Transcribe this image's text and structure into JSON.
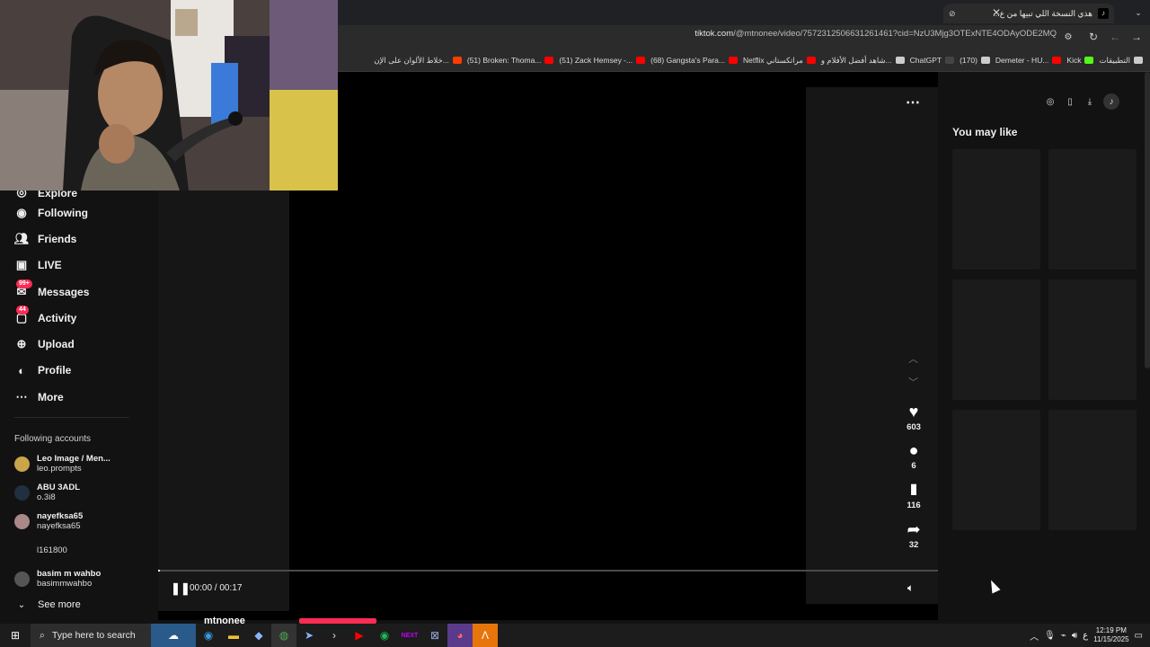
{
  "browser": {
    "tab_title": "هذي النسخة اللي تبيها من ع...",
    "tab_icon": "tiktok-icon",
    "url_host": "tiktok.com",
    "url_path": "/@mtnonee/video/7572312506631261461?cid=NzU3Mjg3OTExNTE4ODAyODE2MQ",
    "bookmarks": [
      {
        "label": "التطبيقات",
        "icon": "apps-grid-icon",
        "color": "#cccccc"
      },
      {
        "label": "Kick",
        "icon": "kick-icon",
        "color": "#53fc18"
      },
      {
        "label": "Demeter - HU...",
        "icon": "youtube-icon",
        "color": "#ff0000"
      },
      {
        "label": "(170)",
        "icon": "chatgpt-icon",
        "color": "#cccccc"
      },
      {
        "label": "ChatGPT",
        "icon": "gpt-icon",
        "color": "#444444"
      },
      {
        "label": "شاهد أفضل الأفلام و...",
        "icon": "globe-icon",
        "color": "#cccccc"
      },
      {
        "label": "Netflix مراتكستاني",
        "icon": "netflix-icon",
        "color": "#ff0000"
      },
      {
        "label": "(68) Gangsta's Para...",
        "icon": "youtube-icon",
        "color": "#ff0000"
      },
      {
        "label": "(51) Zack Hemsey -...",
        "icon": "youtube-icon",
        "color": "#ff0000"
      },
      {
        "label": "(51) Broken: Thoma...",
        "icon": "youtube-icon",
        "color": "#ff0000"
      },
      {
        "label": "خلاط الألوان على الإن...",
        "icon": "google-icon",
        "color": "#ff3d00"
      }
    ]
  },
  "sidebar": {
    "partial_top": "Explore",
    "items": [
      {
        "label": "Following",
        "icon": "following-icon",
        "badge": ""
      },
      {
        "label": "Friends",
        "icon": "friends-icon",
        "badge": ""
      },
      {
        "label": "LIVE",
        "icon": "live-icon",
        "badge": ""
      },
      {
        "label": "Messages",
        "icon": "messages-icon",
        "badge": "99+"
      },
      {
        "label": "Activity",
        "icon": "activity-icon",
        "badge": "44"
      },
      {
        "label": "Upload",
        "icon": "upload-icon",
        "badge": ""
      },
      {
        "label": "Profile",
        "icon": "profile-icon",
        "badge": ""
      },
      {
        "label": "More",
        "icon": "more-icon",
        "badge": ""
      }
    ],
    "following_title": "Following accounts",
    "accounts": [
      {
        "name": "Leo Image / Men...",
        "handle": "leo.prompts"
      },
      {
        "name": "ABU 3ADL",
        "handle": "o.3i8"
      },
      {
        "name": "nayefksa65",
        "handle": "nayefksa65"
      },
      {
        "name": "",
        "handle": "l161800"
      },
      {
        "name": "basim m wahbo",
        "handle": "basimmwahbo"
      }
    ],
    "see_more": "See more"
  },
  "video": {
    "time": "00:00 / 00:17",
    "progress_fraction": 0.0,
    "author": "mtnonee",
    "likes": "603",
    "comments": "6",
    "saves": "116",
    "shares": "32"
  },
  "right": {
    "title": "You may like"
  },
  "taskbar": {
    "search_placeholder": "Type here to search",
    "time": "12:19 PM",
    "date": "11/15/2025",
    "lang": "ع"
  },
  "colors": {
    "accent": "#fe2c55",
    "background": "#121212"
  }
}
